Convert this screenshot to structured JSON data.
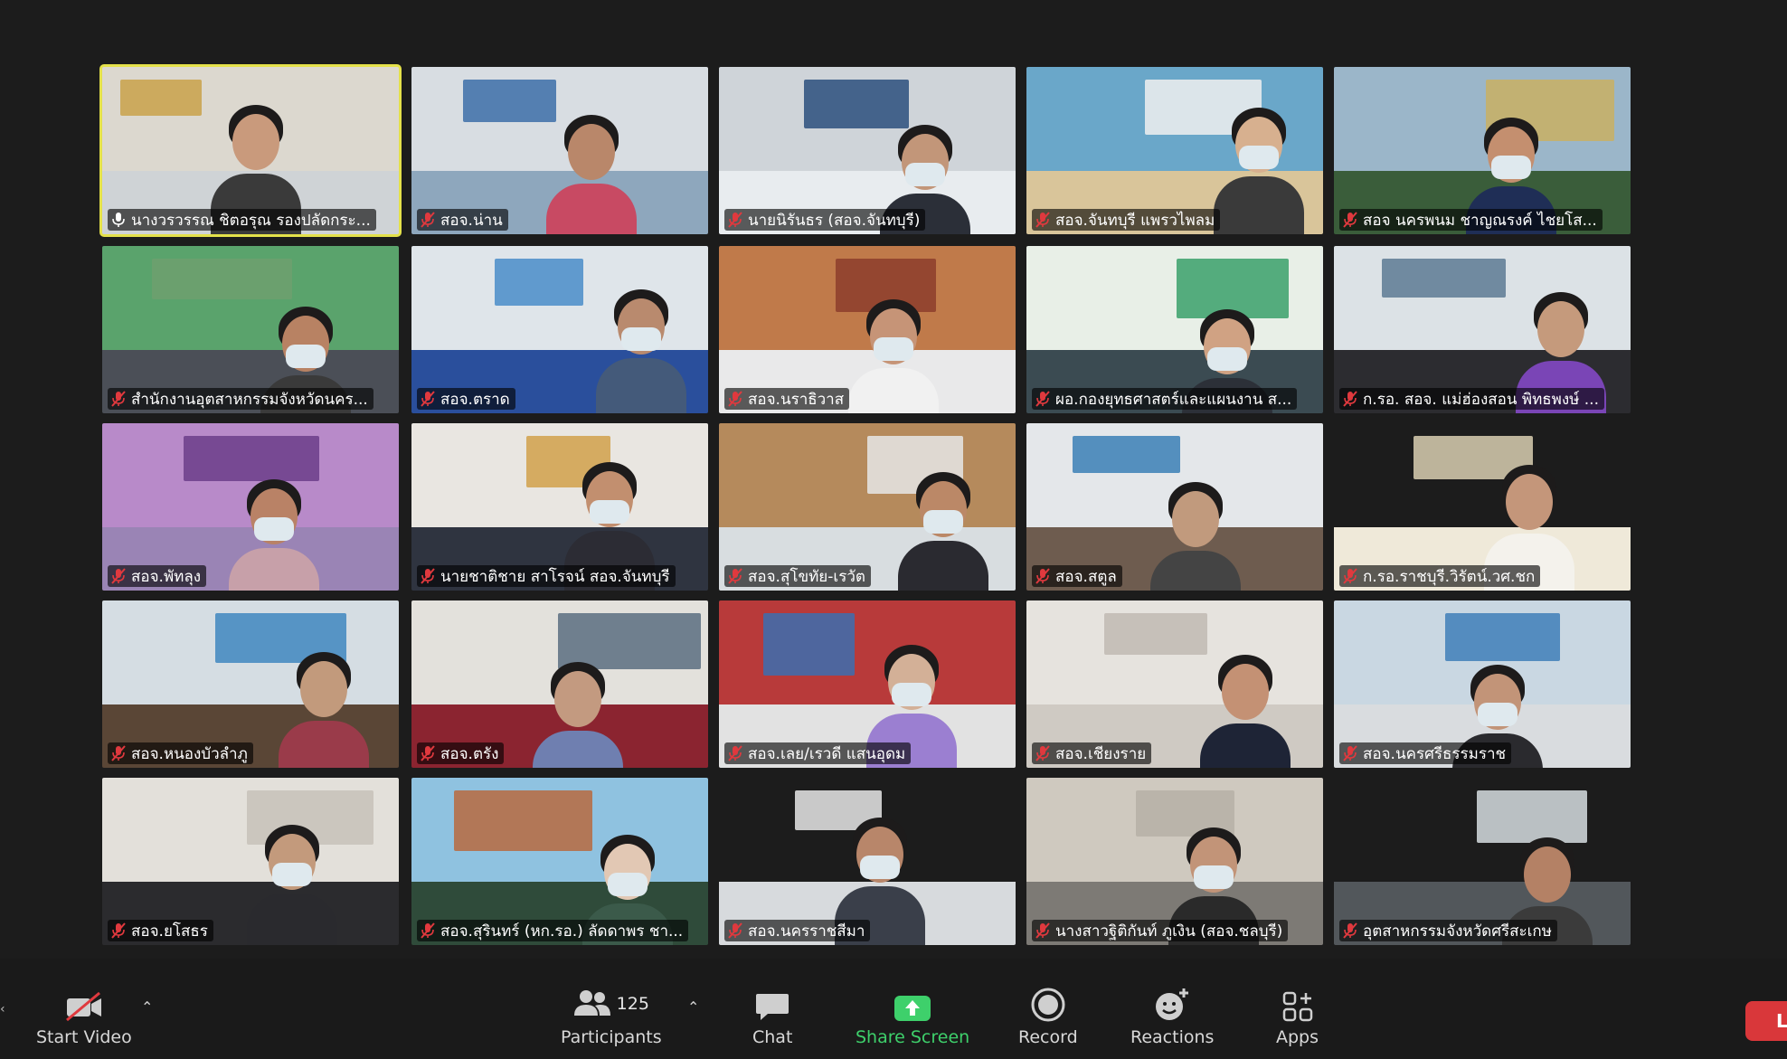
{
  "meeting": {
    "participants": [
      {
        "name": "นางวรวรรณ ชิตอรุณ รองปลัดกระ...",
        "active": true,
        "mic": "mic-icon"
      },
      {
        "name": "สอจ.น่าน",
        "mic": "mic-muted-icon"
      },
      {
        "name": "นายนิรันธร (สอจ.จันทบุรี)",
        "mic": "mic-muted-icon"
      },
      {
        "name": "สอจ.จันทบุรี แพรวไพลม",
        "mic": "mic-muted-icon"
      },
      {
        "name": "สอจ นครพนม ชาญณรงค์ ไชยโส...",
        "mic": "mic-muted-icon"
      },
      {
        "name": "สำนักงานอุตสาหกรรมจังหวัดนคร...",
        "mic": "mic-muted-icon"
      },
      {
        "name": "สอจ.ตราด",
        "mic": "mic-muted-icon"
      },
      {
        "name": "สอจ.นราธิวาส",
        "mic": "mic-muted-icon"
      },
      {
        "name": "ผอ.กองยุทธศาสตร์และแผนงาน ส...",
        "mic": "mic-muted-icon"
      },
      {
        "name": "ก.รอ. สอจ. แม่ฮ่องสอน พิทธพงษ์ ...",
        "mic": "mic-muted-icon"
      },
      {
        "name": "สอจ.พัทลุง",
        "mic": "mic-muted-icon"
      },
      {
        "name": "นายชาติชาย สาโรจน์ สอจ.จันทบุรี",
        "mic": "mic-muted-icon"
      },
      {
        "name": "สอจ.สุโขทัย-เรวัต",
        "mic": "mic-muted-icon"
      },
      {
        "name": "สอจ.สตูล",
        "mic": "mic-muted-icon"
      },
      {
        "name": "ก.รอ.ราชบุรี.วิรัตน์.วศ.ชก",
        "mic": "mic-muted-icon"
      },
      {
        "name": "สอจ.หนองบัวลำภู",
        "mic": "mic-muted-icon"
      },
      {
        "name": "สอจ.ตรัง",
        "mic": "mic-muted-icon"
      },
      {
        "name": "สอจ.เลย/เรวดี แสนอุดม",
        "mic": "mic-muted-icon"
      },
      {
        "name": "สอจ.เชียงราย",
        "mic": "mic-muted-icon"
      },
      {
        "name": "สอจ.นครศรีธรรมราช",
        "mic": "mic-muted-icon"
      },
      {
        "name": "สอจ.ยโสธร",
        "mic": "mic-muted-icon"
      },
      {
        "name": "สอจ.สุรินทร์ (หก.รอ.) ลัดดาพร ชา...",
        "mic": "mic-muted-icon"
      },
      {
        "name": "สอจ.นครราชสีมา",
        "mic": "mic-muted-icon"
      },
      {
        "name": "นางสาวฐิติกันท์ ภูเงิน (สอจ.ชลบุรี)",
        "mic": "mic-muted-icon"
      },
      {
        "name": "อุตสาหกรรมจังหวัดศรีสะเกษ",
        "mic": "mic-muted-icon"
      }
    ]
  },
  "toolbar": {
    "start_video": "Start Video",
    "participants": "Participants",
    "participants_count": "125",
    "chat": "Chat",
    "share_screen": "Share Screen",
    "record": "Record",
    "reactions": "Reactions",
    "apps": "Apps",
    "leave": "Le"
  },
  "colors": {
    "active_speaker_border": "#e4e14a",
    "share_green": "#3ed06b",
    "leave_red": "#d9373a",
    "muted_red": "#e0393e"
  }
}
